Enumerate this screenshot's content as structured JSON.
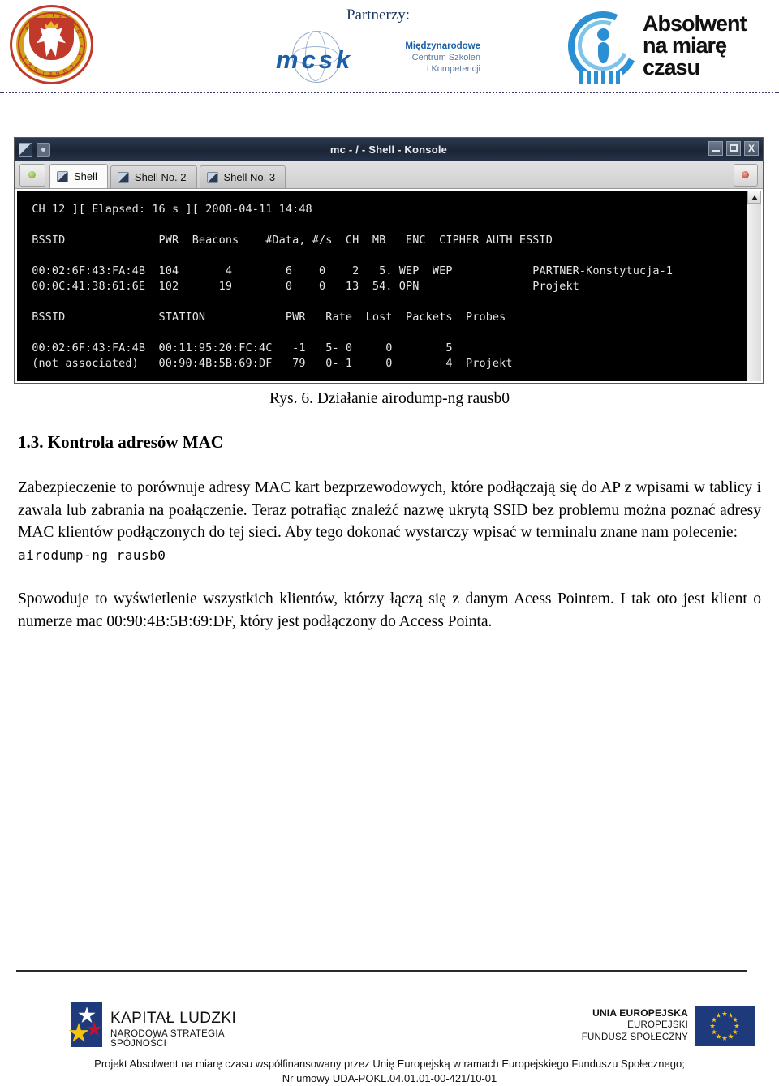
{
  "header": {
    "partners_label": "Partnerzy:",
    "university_logo_text": "POLITECHNIKA LUBELSKA",
    "mcsk": {
      "letters": "mcsk",
      "line1": "Międzynarodowe",
      "line2": "Centrum Szkoleń",
      "line3": "i Kompetencji"
    },
    "absolwent": {
      "line1": "Absolwent",
      "line2": "na miarę",
      "line3": "czasu"
    }
  },
  "konsole": {
    "window_title": "mc - / - Shell - Konsole",
    "tabs": [
      {
        "label": "Shell",
        "active": true
      },
      {
        "label": "Shell No. 2",
        "active": false
      },
      {
        "label": "Shell No. 3",
        "active": false
      }
    ],
    "window_buttons": {
      "minimize": "_",
      "maximize": "□",
      "close": "X"
    },
    "terminal_output": [
      " CH 12 ][ Elapsed: 16 s ][ 2008-04-11 14:48",
      "",
      " BSSID              PWR  Beacons    #Data, #/s  CH  MB   ENC  CIPHER AUTH ESSID",
      "",
      " 00:02:6F:43:FA:4B  104       4        6    0    2   5. WEP  WEP            PARTNER-Konstytucja-1",
      " 00:0C:41:38:61:6E  102      19        0    0   13  54. OPN                 Projekt",
      "",
      " BSSID              STATION            PWR   Rate  Lost  Packets  Probes",
      "",
      " 00:02:6F:43:FA:4B  00:11:95:20:FC:4C   -1   5- 0     0        5",
      " (not associated)   00:90:4B:5B:69:DF   79   0- 1     0        4  Projekt"
    ]
  },
  "document": {
    "figure_caption": "Rys. 6. Działanie airodump-ng rausb0",
    "section_heading": "1.3. Kontrola adresów MAC",
    "paragraph_1": "Zabezpieczenie to porównuje adresy MAC kart bezprzewodowych, które podłączają się do AP z wpisami w tablicy i zawala lub zabrania na poałączenie. Teraz potrafiąc znaleźć nazwę ukrytą SSID bez problemu można poznać adresy MAC klientów podłączonych do tej sieci. Aby tego dokonać wystarczy wpisać w terminalu znane nam polecenie:",
    "command": "airodump-ng rausb0",
    "paragraph_2": "Spowoduje to wyświetlenie wszystkich klientów, którzy łączą się z danym Acess Pointem. I tak oto jest klient o numerze mac 00:90:4B:5B:69:DF, który jest podłączony do Access Pointa."
  },
  "footer": {
    "kapital_ludzki_title": "KAPITAŁ LUDZKI",
    "kapital_ludzki_subtitle": "NARODOWA STRATEGIA SPÓJNOŚCI",
    "eu_line1": "UNIA EUROPEJSKA",
    "eu_line2": "EUROPEJSKI",
    "eu_line3": "FUNDUSZ SPOŁECZNY",
    "note_line1": "Projekt Absolwent na miarę czasu współfinansowany przez Unię Europejską w ramach Europejskiego Funduszu Społecznego;",
    "note_line2": "Nr umowy UDA-POKL.04.01.01-00-421/10-01"
  },
  "colors": {
    "brand_blue": "#1a5fa8",
    "accent_blue": "#2b8fd4",
    "eu_blue": "#1f3a7a",
    "eu_yellow": "#f5c40f",
    "crest_red": "#c0392b",
    "terminal_bg": "#000000",
    "terminal_fg": "#e6e6e6",
    "titlebar": "#1b2535"
  }
}
